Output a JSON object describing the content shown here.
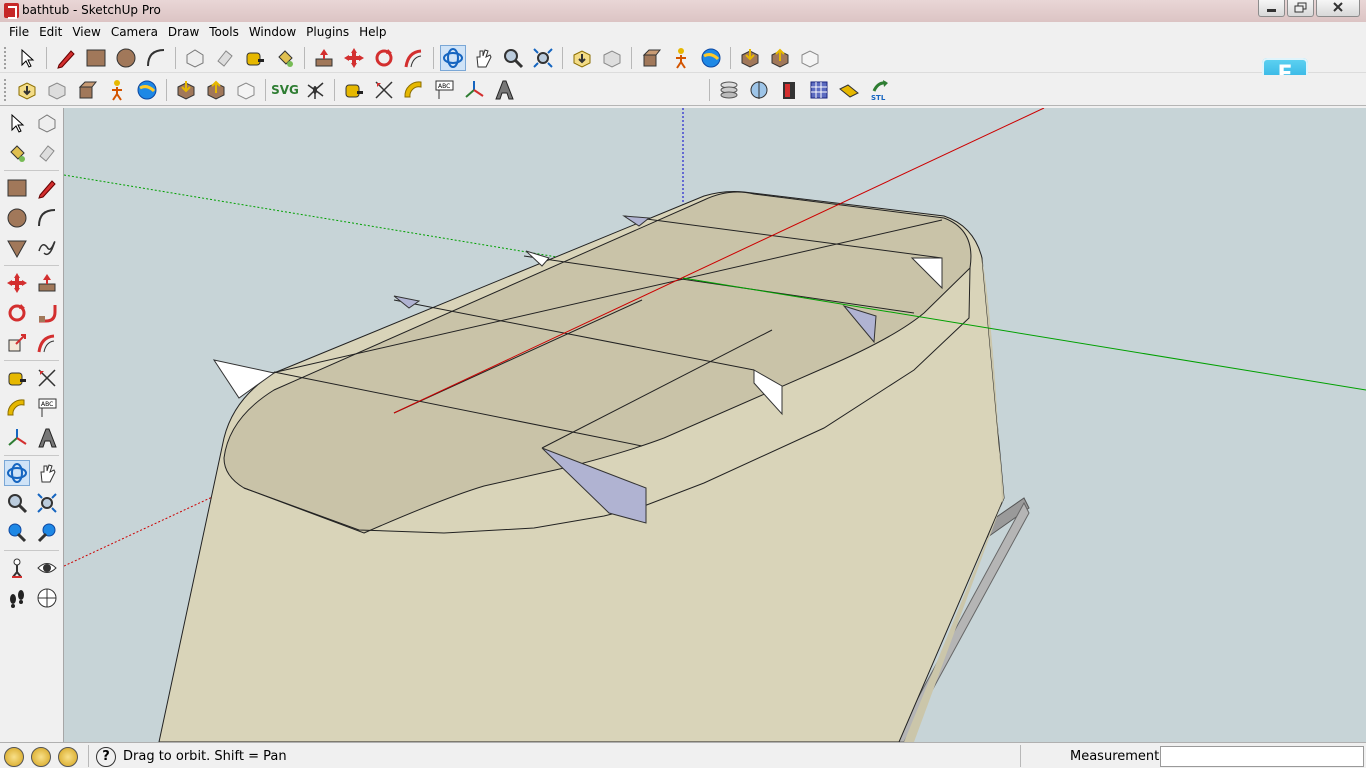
{
  "window": {
    "title": "bathtub - SketchUp Pro"
  },
  "menu": [
    "File",
    "Edit",
    "View",
    "Camera",
    "Draw",
    "Tools",
    "Window",
    "Plugins",
    "Help"
  ],
  "toolbar_top": {
    "icons": [
      "select-icon",
      "pencil-icon",
      "rectangle-icon",
      "circle-icon",
      "arc-icon",
      "make-component-icon",
      "eraser-icon",
      "tape-measure-icon",
      "paint-bucket-icon",
      "push-pull-icon",
      "move-icon",
      "rotate-icon",
      "follow-me-icon",
      "orbit-icon",
      "pan-icon",
      "zoom-icon",
      "zoom-extents-icon",
      "get-models-icon",
      "share-model-icon",
      "share-component-icon",
      "walk-icon",
      "google-earth-icon",
      "import-icon",
      "export-icon",
      "iso-view-icon"
    ]
  },
  "toolbar_second": {
    "svg_label": "SVG"
  },
  "badge": {
    "letter": "F"
  },
  "colors": {
    "viewport_bg": "#c7d4d7",
    "model_fill": "#d9d4b9",
    "axis_red": "#cc0000",
    "axis_green": "#00a000",
    "axis_blue": "#0000cc"
  },
  "status": {
    "hint": "Drag to orbit.  Shift = Pan",
    "help_glyph": "?",
    "measurements_label": "Measurements",
    "measurements_value": ""
  }
}
